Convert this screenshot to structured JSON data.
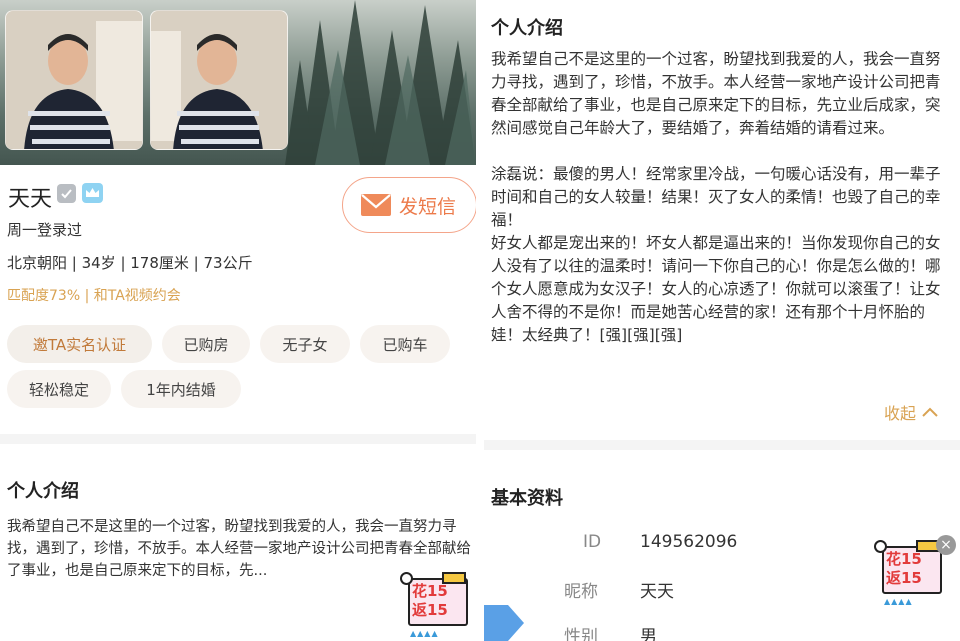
{
  "left": {
    "name": "天天",
    "login_status": "周一登录过",
    "basic_info": "北京朝阳 | 34岁 | 178厘米 | 73公斤",
    "match_info": "匹配度73% | 和TA视频约会",
    "sms_button": "发短信",
    "tags": [
      "邀TA实名认证",
      "已购房",
      "无子女",
      "已购车",
      "轻松稳定",
      "1年内结婚"
    ],
    "intro_title": "个人介绍",
    "intro_short": "我希望自己不是这里的一个过客，盼望找到我爱的人，我会一直努力寻找，遇到了，珍惜，不放手。本人经营一家地产设计公司把青春全部献给了事业，也是自己原来定下的目标，先..."
  },
  "right": {
    "intro_title": "个人介绍",
    "intro_p1": "我希望自己不是这里的一个过客，盼望找到我爱的人，我会一直努力寻找，遇到了，珍惜，不放手。本人经营一家地产设计公司把青春全部献给了事业，也是自己原来定下的目标，先立业后成家，突然间感觉自己年龄大了，要结婚了，奔着结婚的请看过来。",
    "intro_p2": "涂磊说：最傻的男人！经常家里冷战，一句暖心话没有，用一辈子时间和自己的女人较量！结果！灭了女人的柔情！也毁了自己的幸福！",
    "intro_p3": "好女人都是宠出来的！坏女人都是逼出来的！当你发现你自己的女人没有了以往的温柔时！请问一下你自己的心！你是怎么做的！哪个女人愿意成为女汉子！女人的心凉透了！你就可以滚蛋了！让女人舍不得的不是你！而是她苦心经营的家！还有那个十月怀胎的娃！太经典了！[强][强][强]",
    "collapse": "收起",
    "basic_title": "基本资料",
    "rows": [
      {
        "label": "ID",
        "value": "149562096"
      },
      {
        "label": "昵称",
        "value": "天天"
      },
      {
        "label": "性别",
        "value": "男"
      }
    ]
  },
  "promo": {
    "line1": "花15",
    "line2": "返15"
  },
  "colors": {
    "accent_orange": "#ec7a4a",
    "gold": "#d9a353",
    "tag_bg": "#f7f3ef"
  }
}
